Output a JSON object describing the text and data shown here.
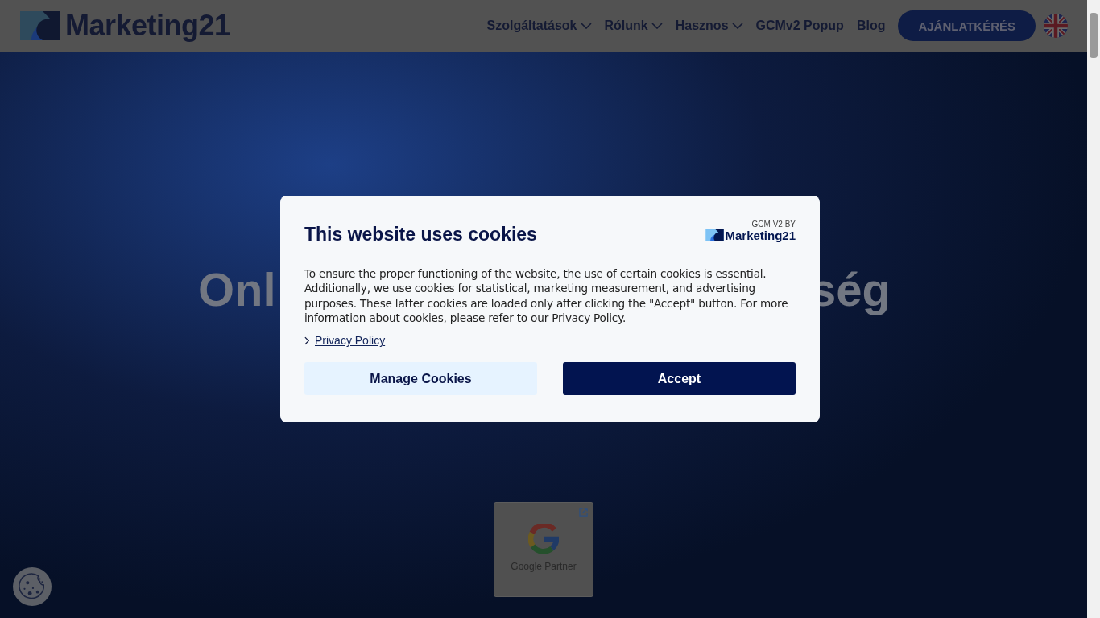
{
  "header": {
    "logo_text": "Marketing21",
    "nav": [
      {
        "label": "Szolgáltatások",
        "dropdown": true
      },
      {
        "label": "Rólunk",
        "dropdown": true
      },
      {
        "label": "Hasznos",
        "dropdown": true
      },
      {
        "label": "GCMv2 Popup",
        "dropdown": false
      },
      {
        "label": "Blog",
        "dropdown": false
      }
    ],
    "cta": "AJÁNLATKÉRÉS"
  },
  "hero": {
    "heading_left": "Onl",
    "heading_right": "ség",
    "badge": "Google Partner"
  },
  "cookie_dialog": {
    "title": "This website uses cookies",
    "brand_caption": "GCM V2 BY",
    "brand_name": "Marketing21",
    "body": "To ensure the proper functioning of the website, the use of certain cookies is essential. Additionally, we use cookies for statistical, marketing measurement, and advertising purposes. These latter cookies are loaded only after clicking the \"Accept\" button. For more information about cookies, please refer to our Privacy Policy.",
    "link": "Privacy Policy",
    "buttons": [
      {
        "label": "Manage Cookies",
        "kind": "secondary"
      },
      {
        "label": "Accept",
        "kind": "primary"
      }
    ]
  }
}
